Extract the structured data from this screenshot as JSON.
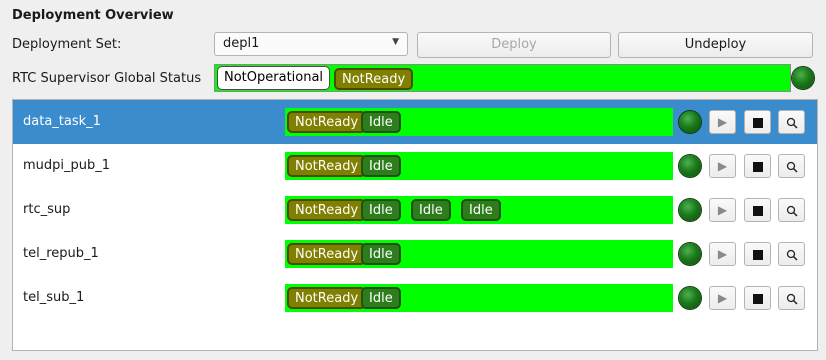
{
  "title": "Deployment Overview",
  "deployment_set": {
    "label": "Deployment Set:",
    "value": "depl1",
    "deploy_label": "Deploy",
    "undeploy_label": "Undeploy"
  },
  "global_status": {
    "label": "RTC Supervisor Global Status",
    "states": [
      "NotOperational",
      "NotReady"
    ],
    "bar_color": "#00ff00",
    "led_color": "#1a7a1a"
  },
  "components": [
    {
      "name": "data_task_1",
      "selected": true,
      "states": [
        "NotReady",
        "Idle"
      ]
    },
    {
      "name": "mudpi_pub_1",
      "selected": false,
      "states": [
        "NotReady",
        "Idle"
      ]
    },
    {
      "name": "rtc_sup",
      "selected": false,
      "states": [
        "NotReady",
        "Idle",
        "Idle",
        "Idle"
      ]
    },
    {
      "name": "tel_repub_1",
      "selected": false,
      "states": [
        "NotReady",
        "Idle"
      ]
    },
    {
      "name": "tel_sub_1",
      "selected": false,
      "states": [
        "NotReady",
        "Idle"
      ]
    }
  ],
  "colors": {
    "ok_bar": "#00ff00",
    "not_ready": "#808000",
    "idle": "#2e7d1c",
    "selection": "#3b8ccd"
  },
  "icons": {
    "led": "green-led-icon",
    "start": "play-icon",
    "stop": "stop-icon",
    "inspect": "magnifier-icon",
    "dropdown": "chevron-down-icon"
  }
}
